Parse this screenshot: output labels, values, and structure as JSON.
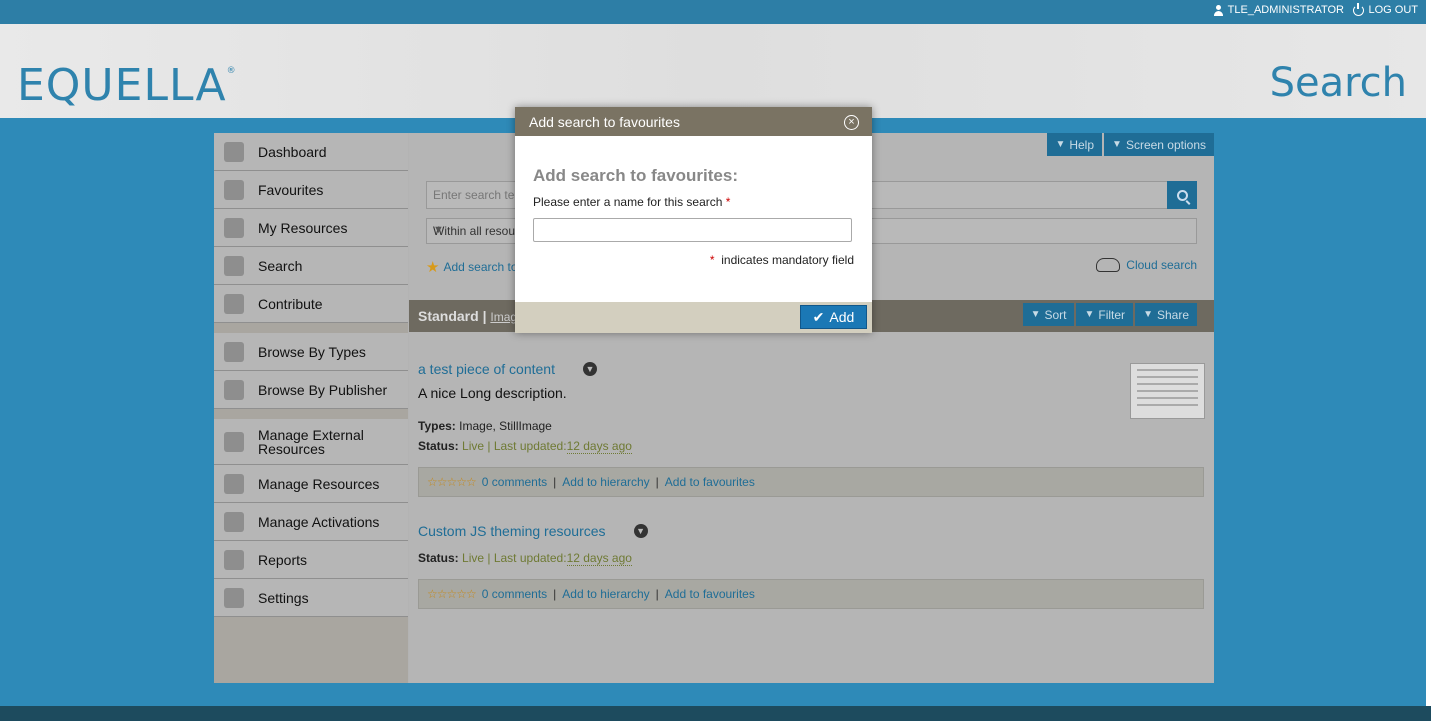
{
  "topbar": {
    "user": "TLE_ADMINISTRATOR",
    "logout": "LOG OUT"
  },
  "header": {
    "logo": "EQUELLA",
    "logo_mark": "®",
    "page_title": "Search"
  },
  "sidebar": {
    "items": [
      {
        "label": "Dashboard",
        "icon": "dashboard-icon"
      },
      {
        "label": "Favourites",
        "icon": "star-icon"
      },
      {
        "label": "My Resources",
        "icon": "database-icon"
      },
      {
        "label": "Search",
        "icon": "magnifier-icon"
      },
      {
        "label": "Contribute",
        "icon": "pencil-icon"
      },
      {
        "label": "Browse By Types",
        "icon": "books-icon"
      },
      {
        "label": "Browse By Publisher",
        "icon": "books-icon"
      },
      {
        "label": "Manage External Resources",
        "icon": "globe-icon"
      },
      {
        "label": "Manage Resources",
        "icon": "database-check-icon"
      },
      {
        "label": "Manage Activations",
        "icon": "clipboard-icon"
      },
      {
        "label": "Reports",
        "icon": "chart-icon"
      },
      {
        "label": "Settings",
        "icon": "gear-icon"
      }
    ]
  },
  "toolbar": {
    "help": "Help",
    "screen_options": "Screen options"
  },
  "search": {
    "placeholder": "Enter search te",
    "within": "Within all resou",
    "add_search": "Add search to",
    "cloud_search": "Cloud search"
  },
  "results_bar": {
    "standard": "Standard",
    "image_link": "Imag",
    "sort": "Sort",
    "filter": "Filter",
    "share": "Share"
  },
  "results": [
    {
      "title": "a test piece of content",
      "description": "A nice Long description.",
      "types_label": "Types:",
      "types": "Image, StillImage",
      "status_label": "Status:",
      "status": "Live",
      "updated_label": "| Last updated:",
      "updated": "12 days ago",
      "comments": "0 comments",
      "hierarchy": "Add to hierarchy",
      "favourites": "Add to favourites"
    },
    {
      "title": "Custom JS theming resources",
      "status_label": "Status:",
      "status": "Live",
      "updated_label": "| Last updated:",
      "updated": "12 days ago",
      "comments": "0 comments",
      "hierarchy": "Add to hierarchy",
      "favourites": "Add to favourites"
    }
  ],
  "dialog": {
    "title": "Add search to favourites",
    "heading": "Add search to favourites:",
    "label": "Please enter a name for this search",
    "required_mark": "*",
    "input_value": "",
    "mandatory_note": "indicates mandatory field",
    "add_button": "Add"
  },
  "colors": {
    "accent": "#1f6d96",
    "brand": "#2f83ad",
    "dialog_header": "#7a7363"
  }
}
